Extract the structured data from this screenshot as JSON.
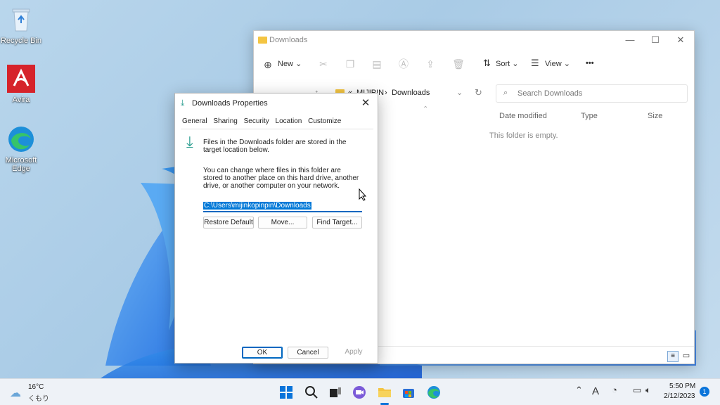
{
  "desktop": {
    "icons": [
      {
        "label": "Recycle Bin"
      },
      {
        "label": "Avira"
      },
      {
        "label": "Microsoft Edge"
      }
    ]
  },
  "explorer": {
    "title": "Downloads",
    "toolbar": {
      "new_label": "New",
      "sort_label": "Sort",
      "view_label": "View",
      "more_label": "•••"
    },
    "address": {
      "prefix": "«",
      "parent": "MIJIPIN",
      "separator": "›",
      "current": "Downloads"
    },
    "search_placeholder": "Search Downloads",
    "columns": [
      "Date modified",
      "Type",
      "Size"
    ],
    "empty_message": "This folder is empty."
  },
  "dialog": {
    "title": "Downloads Properties",
    "tabs": [
      "General",
      "Sharing",
      "Security",
      "Location",
      "Customize"
    ],
    "active_tab": "Location",
    "info_text": "Files in the Downloads folder are stored in the target location below.",
    "help_text": "You can change where files in this folder are stored to another place on this hard drive, another drive, or another computer on your network.",
    "path_value": "C:\\Users\\mijinkopinpin\\Downloads",
    "buttons": {
      "restore_default": "Restore Default",
      "move": "Move...",
      "find_target": "Find Target...",
      "ok": "OK",
      "cancel": "Cancel",
      "apply": "Apply"
    }
  },
  "taskbar": {
    "weather_temp": "16°C",
    "weather_desc": "くもり",
    "time": "5:50 PM",
    "date": "2/12/2023",
    "notification_count": "1",
    "ime_label": "A"
  },
  "colors": {
    "accent": "#0067c0",
    "wallpaper": "#b9d6ec",
    "avira_red": "#d6232b",
    "folder_yellow": "#f4c542"
  }
}
